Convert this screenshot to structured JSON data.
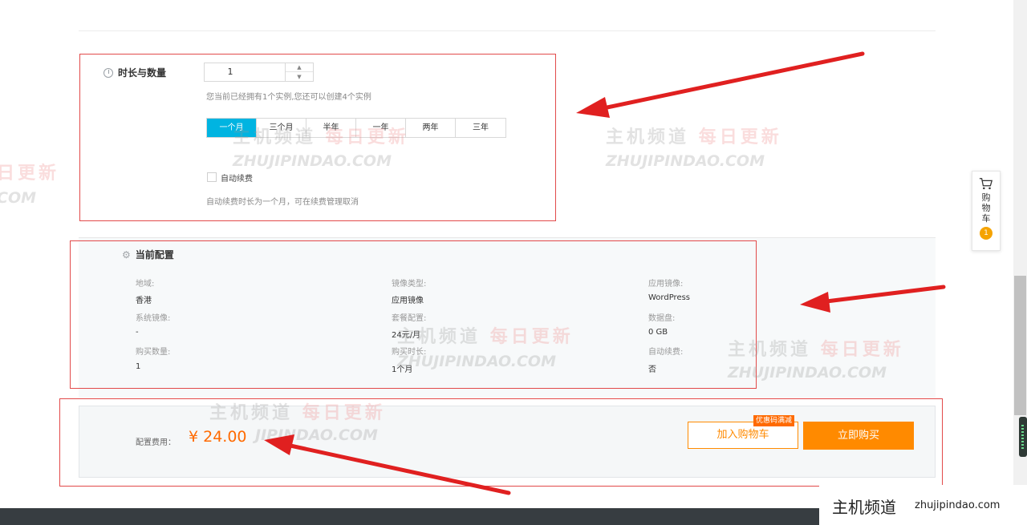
{
  "duration_section": {
    "title": "时长与数量",
    "quantity_value": "1",
    "instance_hint": "您当前已经拥有1个实例,您还可以创建4个实例",
    "periods": [
      "一个月",
      "三个月",
      "半年",
      "一年",
      "两年",
      "三年"
    ],
    "selected_period": "一个月",
    "auto_renew_label": "自动续费",
    "auto_renew_checked": false,
    "auto_renew_hint": "自动续费时长为一个月，可在续费管理取消"
  },
  "config_section": {
    "title": "当前配置",
    "items": [
      {
        "label": "地域:",
        "value": "香港"
      },
      {
        "label": "镜像类型:",
        "value": "应用镜像"
      },
      {
        "label": "应用镜像:",
        "value": "WordPress"
      },
      {
        "label": "系统镜像:",
        "value": "-"
      },
      {
        "label": "套餐配置:",
        "value": "24元/月"
      },
      {
        "label": "数据盘:",
        "value": "0 GB"
      },
      {
        "label": "购买数量:",
        "value": "1"
      },
      {
        "label": "购买时长:",
        "value": "1个月"
      },
      {
        "label": "自动续费:",
        "value": "否"
      }
    ]
  },
  "footer": {
    "price_label": "配置费用：",
    "price": "¥ 24.00",
    "add_to_cart_label": "加入购物车",
    "promo_badge": "优惠码满减",
    "buy_now_label": "立即购买"
  },
  "float_cart": {
    "label": "购物车",
    "count": "1"
  },
  "watermark": {
    "cn_main": "主机频道",
    "cn_sub": "每日更新",
    "cn_partial": "日更新",
    "en": "ZHUJIPINDAO.COM",
    "en_partial_1": "COM",
    "en_partial_2": "JIPINDAO.COM"
  },
  "brand": {
    "cn": "主机频道",
    "en": "zhujipindao.com"
  },
  "colors": {
    "accent_blue": "#00b4e1",
    "accent_orange": "#ff8a00",
    "price_orange": "#ff6a00",
    "annotation_red": "#e02020"
  }
}
